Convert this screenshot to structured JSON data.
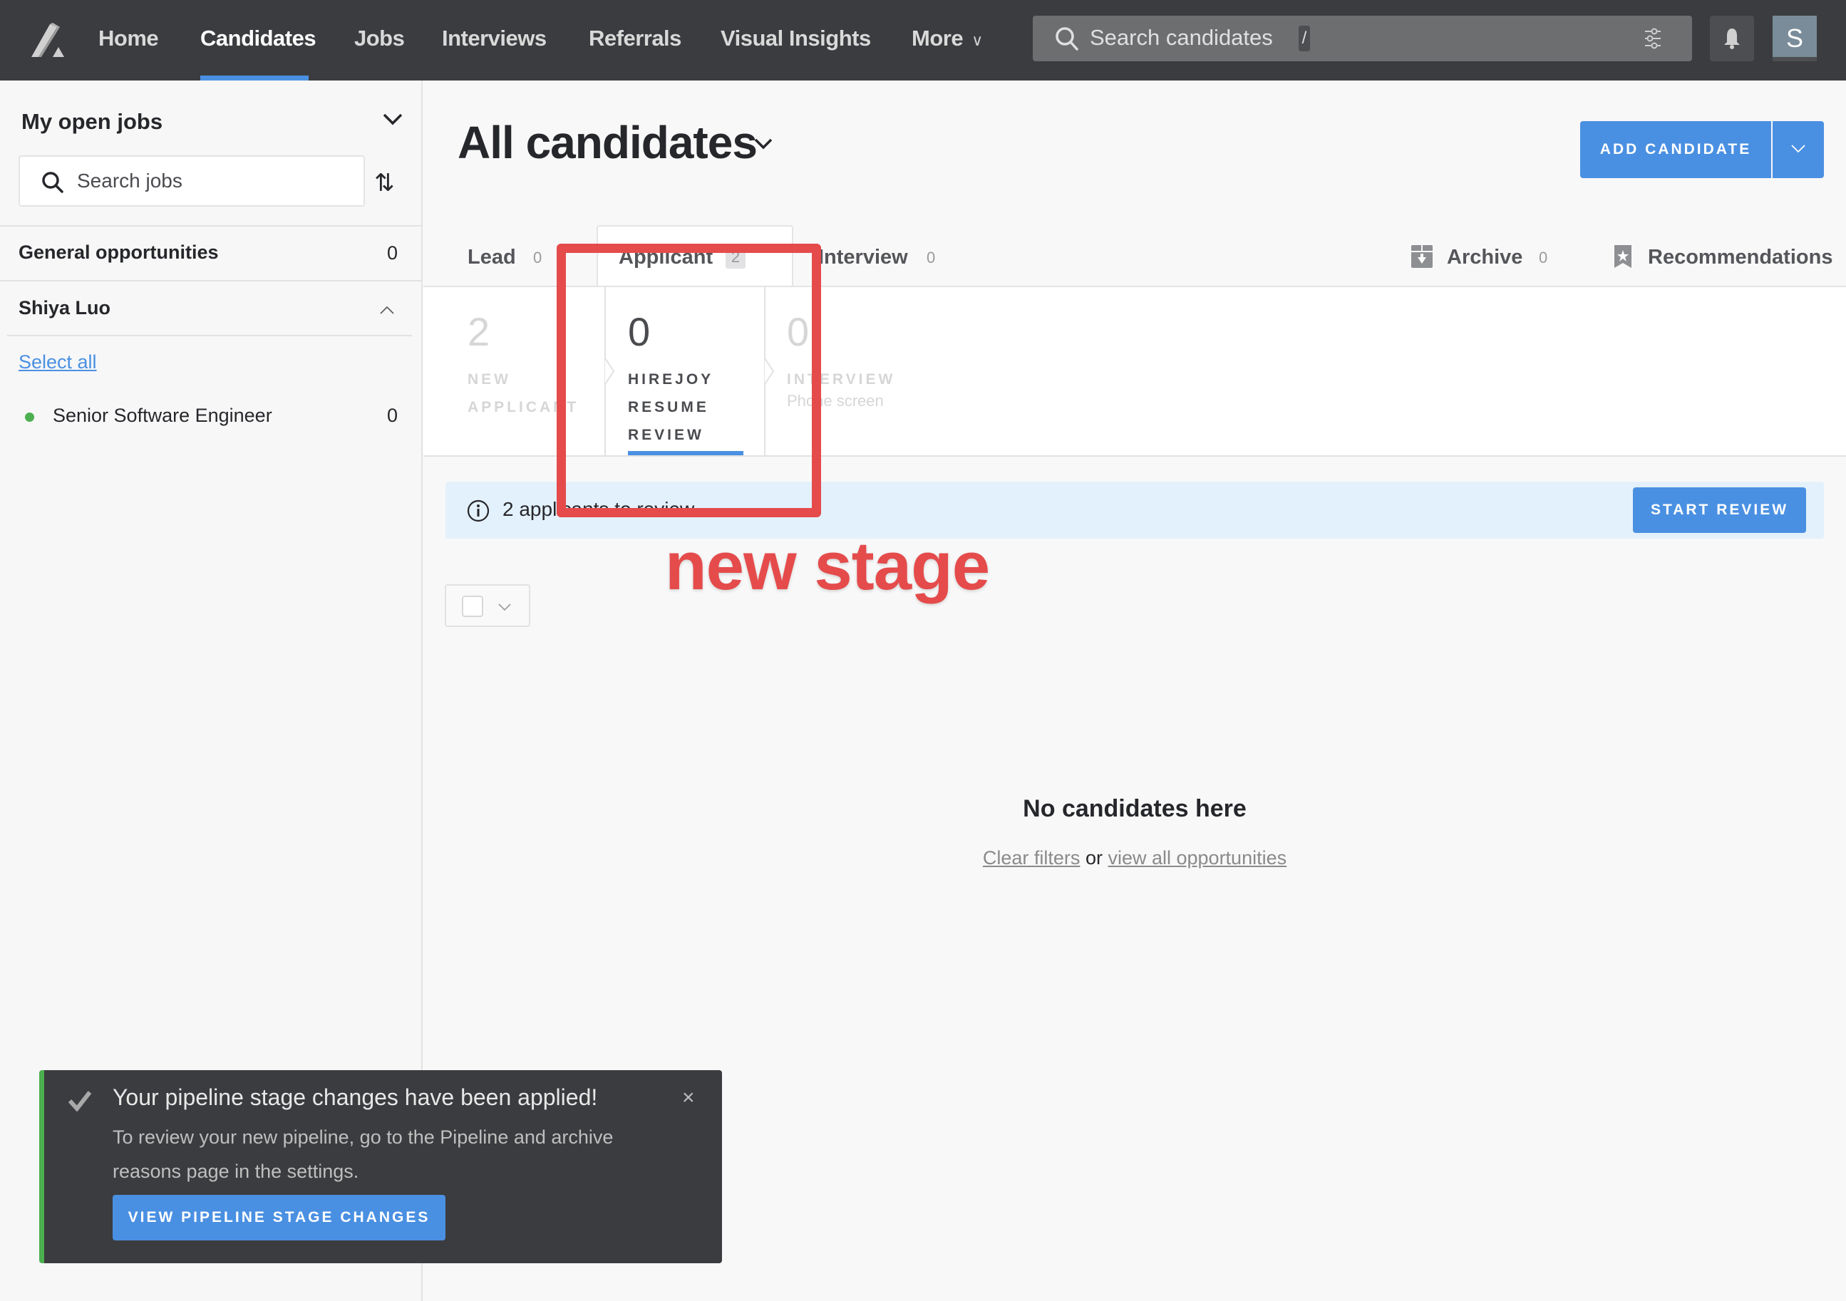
{
  "topnav": {
    "items": [
      {
        "label": "Home",
        "active": false
      },
      {
        "label": "Candidates",
        "active": true
      },
      {
        "label": "Jobs",
        "active": false
      },
      {
        "label": "Interviews",
        "active": false
      },
      {
        "label": "Referrals",
        "active": false
      },
      {
        "label": "Visual Insights",
        "active": false
      },
      {
        "label": "More",
        "active": false
      }
    ],
    "search": {
      "placeholder": "Search candidates",
      "shortcut": "/"
    },
    "avatar_initial": "S",
    "accent": "#4a90e2"
  },
  "sidebar": {
    "title": "My open jobs",
    "search_placeholder": "Search jobs",
    "general": {
      "label": "General opportunities",
      "count": "0"
    },
    "group": {
      "label": "Shiya Luo",
      "select_all": "Select all"
    },
    "jobs": [
      {
        "name": "Senior Software Engineer",
        "count": "0",
        "status_color": "#4caf50"
      }
    ]
  },
  "main": {
    "title": "All candidates",
    "add_candidate_label": "ADD CANDIDATE",
    "tabs": [
      {
        "label": "Lead",
        "count": "0"
      },
      {
        "label": "Applicant",
        "count": "2",
        "active": true
      },
      {
        "label": "Interview",
        "count": "0"
      },
      {
        "label": "Archive",
        "count": "0"
      },
      {
        "label": "Recommendations",
        "count": ""
      }
    ],
    "stages": [
      {
        "count": "2",
        "label_lines": [
          "NEW",
          "APPLICANT"
        ],
        "sub": ""
      },
      {
        "count": "0",
        "label_lines": [
          "HIREJOY",
          "RESUME",
          "REVIEW"
        ],
        "sub": "",
        "selected": true
      },
      {
        "count": "0",
        "label_lines": [
          "INTERVIEW"
        ],
        "sub": "Phone screen"
      }
    ],
    "banner": {
      "text": "2 applicants to review",
      "button": "START REVIEW"
    },
    "empty": {
      "title": "No candidates here",
      "clear_filters": "Clear filters",
      "or": "or",
      "view_all": "view all opportunities"
    }
  },
  "toast": {
    "title": "Your pipeline stage changes have been applied!",
    "body": "To review your new pipeline, go to the Pipeline and archive reasons page in the settings.",
    "button": "VIEW PIPELINE STAGE CHANGES",
    "close": "×"
  },
  "annotation": {
    "text": "new stage",
    "color": "#e54b4b"
  }
}
